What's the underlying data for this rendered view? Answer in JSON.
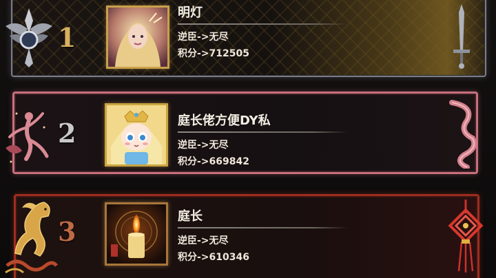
{
  "leaderboard": {
    "entries": [
      {
        "rank": "1",
        "name": "明灯",
        "title_line": "逆臣->无尽",
        "score_line": "积分->712505"
      },
      {
        "rank": "2",
        "name": "庭长佬方便DY私",
        "title_line": "逆臣->无尽",
        "score_line": "积分->669842"
      },
      {
        "rank": "3",
        "name": "庭长",
        "title_line": "逆臣->无尽",
        "score_line": "积分->610346"
      }
    ]
  },
  "colors": {
    "gold_rank": "#d9b062",
    "silver_rank": "#c9c9c9",
    "bronze_rank": "#c06a44",
    "row2_frame": "#c8707d",
    "row3_frame": "#9f2c20",
    "text": "#f1ebe0"
  },
  "icons": {
    "row1_emblem": "winged-silver-crest-icon",
    "row1_avatar": "angel-portrait-avatar",
    "row1_ornament": "silver-sword-ornament-icon",
    "row2_emblem": "dancing-figure-emblem-icon",
    "row2_avatar": "chibi-princess-avatar",
    "row2_ornament": "ribbon-scroll-ornament-icon",
    "row3_emblem": "golden-horse-emblem-icon",
    "row3_avatar": "candle-avatar",
    "row3_ornament": "chinese-knot-ornament-icon"
  }
}
